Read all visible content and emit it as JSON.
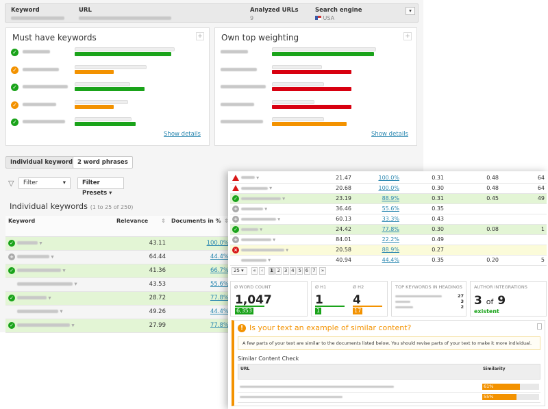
{
  "header": {
    "keyword_label": "Keyword",
    "url_label": "URL",
    "analyzed_label": "Analyzed URLs",
    "analyzed_value": "9",
    "engine_label": "Search engine",
    "engine_value": "USA"
  },
  "colors": {
    "green": "#1aa31a",
    "orange": "#f39200",
    "red": "#d80010",
    "link": "#2a87b0"
  },
  "must_have": {
    "title": "Must have keywords",
    "show_details": "Show details",
    "rows": [
      {
        "status": "ok",
        "color": "green",
        "track": 0.97,
        "fill": 0.94
      },
      {
        "status": "warn",
        "color": "orange",
        "track": 0.7,
        "fill": 0.38
      },
      {
        "status": "ok",
        "color": "green",
        "track": 0.54,
        "fill": 0.68
      },
      {
        "status": "warn",
        "color": "orange",
        "track": 0.52,
        "fill": 0.38
      },
      {
        "status": "ok",
        "color": "green",
        "track": 0.55,
        "fill": 0.59
      }
    ]
  },
  "own_top": {
    "title": "Own top weighting",
    "show_details": "Show details",
    "rows": [
      {
        "color": "green",
        "track": 0.98,
        "fill": 0.96
      },
      {
        "color": "red",
        "track": 0.47,
        "fill": 0.75
      },
      {
        "color": "red",
        "track": 0.49,
        "fill": 0.75
      },
      {
        "color": "red",
        "track": 0.4,
        "fill": 0.75
      },
      {
        "color": "orange",
        "track": 0.49,
        "fill": 0.7
      }
    ]
  },
  "tabs": [
    "Individual keywords",
    "2 word phrases"
  ],
  "filter": {
    "label": "Filter",
    "presets": "Filter Presets"
  },
  "list": {
    "title": "Individual keywords",
    "range": "(1 to 25 of 250)",
    "columns": [
      "Keyword",
      "Relevance",
      "Documents in %"
    ],
    "rows": [
      {
        "icon": "check",
        "hl": "g",
        "relevance": "43.11",
        "docs": "100.0%"
      },
      {
        "icon": "plus",
        "hl": "",
        "relevance": "64.44",
        "docs": "44.4%"
      },
      {
        "icon": "check",
        "hl": "g",
        "relevance": "41.36",
        "docs": "66.7%"
      },
      {
        "icon": "",
        "hl": "",
        "relevance": "43.53",
        "docs": "55.6%"
      },
      {
        "icon": "check",
        "hl": "g",
        "relevance": "28.72",
        "docs": "77.8%"
      },
      {
        "icon": "",
        "hl": "",
        "relevance": "49.26",
        "docs": "44.4%"
      },
      {
        "icon": "check",
        "hl": "g",
        "relevance": "27.99",
        "docs": "77.8%"
      }
    ]
  },
  "detail_rows": [
    {
      "icon": "warn",
      "hl": "",
      "c1": "21.47",
      "c2": "100.0%",
      "c3": "0.31",
      "c4": "0.48",
      "c5": "64"
    },
    {
      "icon": "warn",
      "hl": "",
      "c1": "20.68",
      "c2": "100.0%",
      "c3": "0.30",
      "c4": "0.48",
      "c5": "64"
    },
    {
      "icon": "check",
      "hl": "g",
      "c1": "23.19",
      "c2": "88.9%",
      "c3": "0.31",
      "c4": "0.45",
      "c5": "49"
    },
    {
      "icon": "plus",
      "hl": "",
      "c1": "36.46",
      "c2": "55.6%",
      "c3": "0.35",
      "c4": "",
      "c5": ""
    },
    {
      "icon": "plus",
      "hl": "",
      "c1": "60.13",
      "c2": "33.3%",
      "c3": "0.43",
      "c4": "",
      "c5": ""
    },
    {
      "icon": "check",
      "hl": "g",
      "c1": "24.42",
      "c2": "77.8%",
      "c3": "0.30",
      "c4": "0.08",
      "c5": "1"
    },
    {
      "icon": "plus",
      "hl": "",
      "c1": "84.01",
      "c2": "22.2%",
      "c3": "0.49",
      "c4": "",
      "c5": ""
    },
    {
      "icon": "error",
      "hl": "y",
      "c1": "20.58",
      "c2": "88.9%",
      "c3": "0.27",
      "c4": "",
      "c5": ""
    },
    {
      "icon": "",
      "hl": "",
      "c1": "40.94",
      "c2": "44.4%",
      "c3": "0.35",
      "c4": "0.20",
      "c5": "5"
    }
  ],
  "pagination": {
    "per_page": "25",
    "pages": [
      "1",
      "2",
      "3",
      "4",
      "5",
      "6",
      "7"
    ],
    "current": "1"
  },
  "stats": {
    "word_count": {
      "label": "Ø WORD COUNT",
      "value": "1,047",
      "badge": "6,353"
    },
    "h1": {
      "label": "Ø H1",
      "value": "1",
      "badge": "1"
    },
    "h2": {
      "label": "Ø H2",
      "value": "4",
      "badge": "17"
    },
    "top_kw": {
      "label": "TOP KEYWORDS IN HEADINGS",
      "counts": [
        "27",
        "3",
        "2"
      ]
    },
    "author": {
      "label": "AUTHOR INTEGRATIONS",
      "value": "3",
      "of": "of",
      "total": "9",
      "status": "existent"
    }
  },
  "similar": {
    "title": "Is your text an example of similar content?",
    "notice": "A few parts of your text are similar to the documents listed below. You should revise parts of your text to make it more individual.",
    "section": "Similar Content Check",
    "col_url": "URL",
    "col_sim": "Similarity",
    "rows": [
      {
        "sim": "61%",
        "value": 0.61
      },
      {
        "sim": "55%",
        "value": 0.55
      }
    ]
  }
}
